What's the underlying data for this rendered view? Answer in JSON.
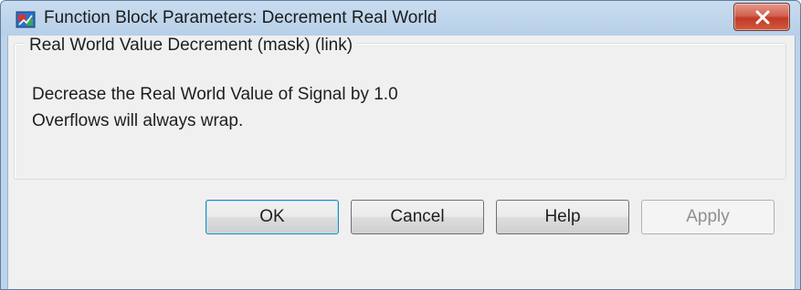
{
  "window": {
    "title": "Function Block Parameters: Decrement Real World"
  },
  "group": {
    "title": "Real World Value Decrement (mask) (link)",
    "description_lines": [
      "Decrease the Real World Value of Signal by 1.0",
      "Overflows will always wrap."
    ]
  },
  "buttons": {
    "ok": "OK",
    "cancel": "Cancel",
    "help": "Help",
    "apply": "Apply",
    "apply_enabled": false
  },
  "icons": {
    "app": "simulink-block-icon",
    "close": "close-icon"
  },
  "colors": {
    "frame": "#bdd3ea",
    "client": "#f0f0f0",
    "close_button": "#c94a35",
    "ok_focus_border": "#3c7fb1",
    "disabled_text": "#8f8f8f"
  }
}
